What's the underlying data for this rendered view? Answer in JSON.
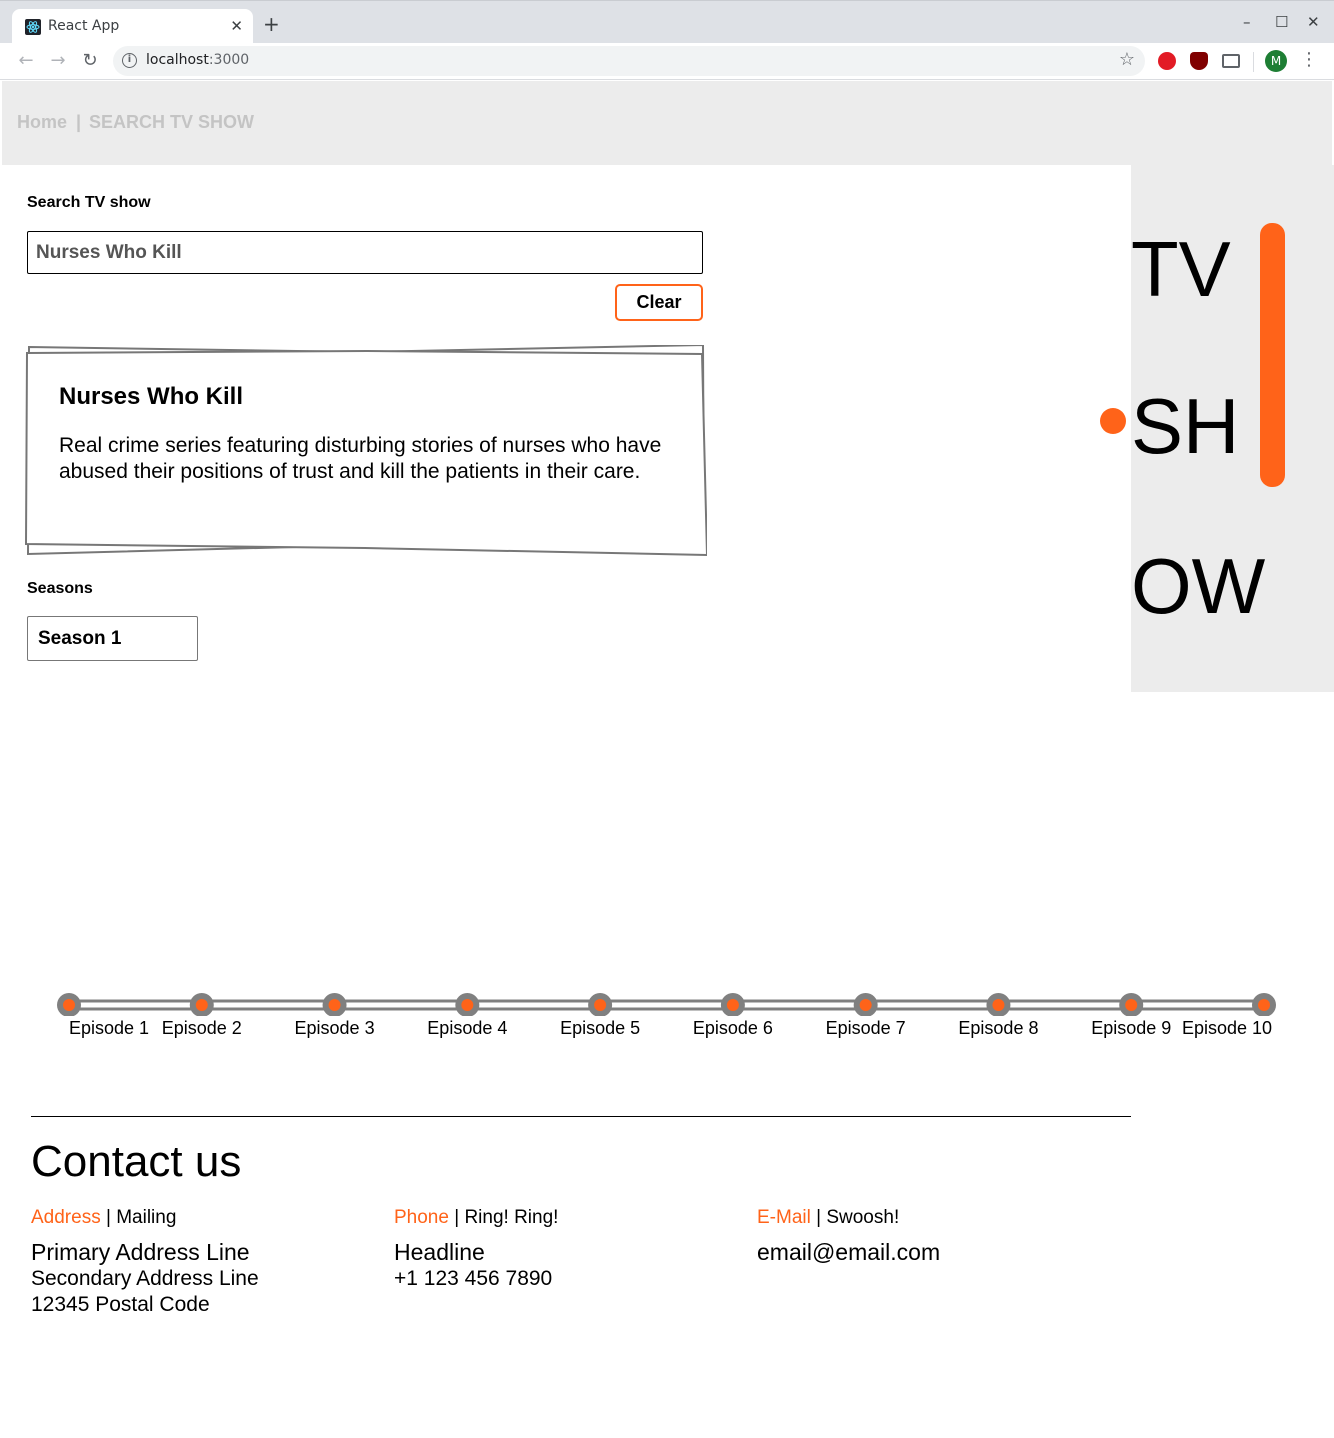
{
  "browser": {
    "tab_title": "React App",
    "tab_close": "✕",
    "new_tab": "+",
    "url_host": "localhost",
    "url_port": ":3000",
    "avatar_letter": "M",
    "window": {
      "minimize": "–",
      "maximize": "☐",
      "close": "✕"
    }
  },
  "nav": {
    "home": "Home",
    "separator": "|",
    "current": "SEARCH TV SHOW"
  },
  "search": {
    "label": "Search TV show",
    "value": "Nurses Who Kill",
    "clear_label": "Clear"
  },
  "show": {
    "title": "Nurses Who Kill",
    "description": "Real crime series featuring disturbing stories of nurses who have abused their positions of trust and kill the patients in their care."
  },
  "seasons": {
    "label": "Seasons",
    "selected": "Season 1"
  },
  "side_letters": [
    "TV",
    "SH",
    "OW"
  ],
  "episodes": [
    "Episode 1",
    "Episode 2",
    "Episode 3",
    "Episode 4",
    "Episode 5",
    "Episode 6",
    "Episode 7",
    "Episode 8",
    "Episode 9",
    "Episode 10"
  ],
  "contact": {
    "title": "Contact us",
    "address": {
      "accent": "Address",
      "sep": " | ",
      "sub": "Mailing",
      "line1": "Primary Address Line",
      "line2": "Secondary Address Line",
      "line3": "12345 Postal Code"
    },
    "phone": {
      "accent": "Phone",
      "sep": " | ",
      "sub": "Ring! Ring!",
      "line1": "Headline",
      "line2": "+1 123 456 7890"
    },
    "email": {
      "accent": "E-Mail",
      "sep": " | ",
      "sub": "Swoosh!",
      "line1": "email@email.com"
    }
  },
  "colors": {
    "accent": "#ff6319",
    "panel": "#ececec",
    "track": "#808080"
  }
}
